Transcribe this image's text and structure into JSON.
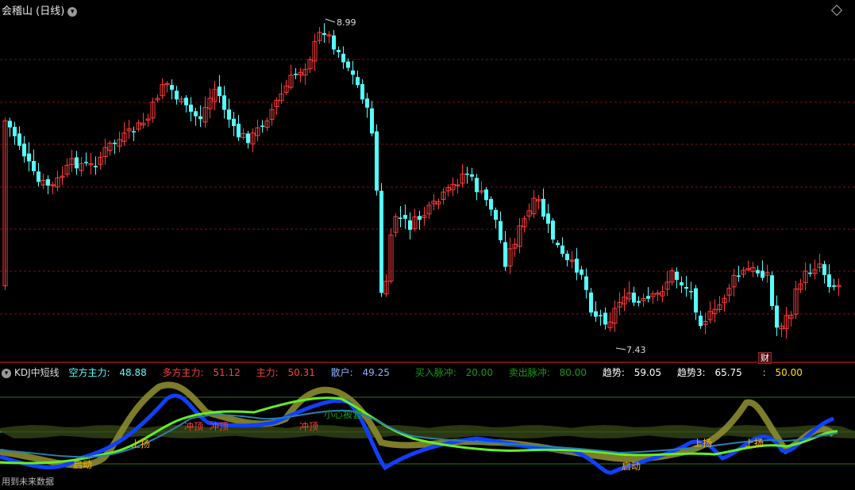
{
  "main_chart": {
    "title": "会稽山 (日线)",
    "high_label": "8.99",
    "low_label": "7.43",
    "finance_button": "财",
    "colors": {
      "up": "#ff3b3b",
      "down": "#54ffff",
      "grid": "#7a1010",
      "background": "#000000"
    }
  },
  "indicator": {
    "name": "KDJ中短线",
    "values": [
      {
        "label": "空方主力:",
        "value": "48.88",
        "color": "#54ffff"
      },
      {
        "label": "多方主力:",
        "value": "51.12",
        "color": "#ff4040"
      },
      {
        "label": "主力:",
        "value": "50.31",
        "color": "#ff4040"
      },
      {
        "label": "散户:",
        "value": "49.25",
        "color": "#8fb0ff"
      },
      {
        "label": "买入脉冲:",
        "value": "20.00",
        "color": "#1a9a1a"
      },
      {
        "label": "卖出脉冲:",
        "value": "80.00",
        "color": "#1a9a1a"
      },
      {
        "label": "趋势:",
        "value": "59.05",
        "color": "#ffffff"
      },
      {
        "label": "趋势3:",
        "value": "65.75",
        "color": "#ffffff"
      },
      {
        "label": ":",
        "value": "50.00",
        "color": "#ffe000"
      }
    ],
    "signals": [
      {
        "text": "上扬",
        "color": "#ffb000",
        "name": "signal-rise-1"
      },
      {
        "text": "冲顶",
        "color": "#ff4040",
        "name": "signal-peak-1"
      },
      {
        "text": "冲顶",
        "color": "#ff4040",
        "name": "signal-peak-2"
      },
      {
        "text": "冲顶",
        "color": "#ff4040",
        "name": "signal-peak-3"
      },
      {
        "text": "小心被套",
        "color": "#1a9a1a",
        "name": "signal-caution"
      },
      {
        "text": "启动",
        "color": "#ffb000",
        "name": "signal-start-1"
      },
      {
        "text": "启动",
        "color": "#ffb000",
        "name": "signal-start-2"
      },
      {
        "text": "上扬",
        "color": "#ffb000",
        "name": "signal-rise-2"
      },
      {
        "text": "上扬",
        "color": "#ffb000",
        "name": "signal-rise-3"
      }
    ],
    "footer": "用到未来数据"
  }
}
